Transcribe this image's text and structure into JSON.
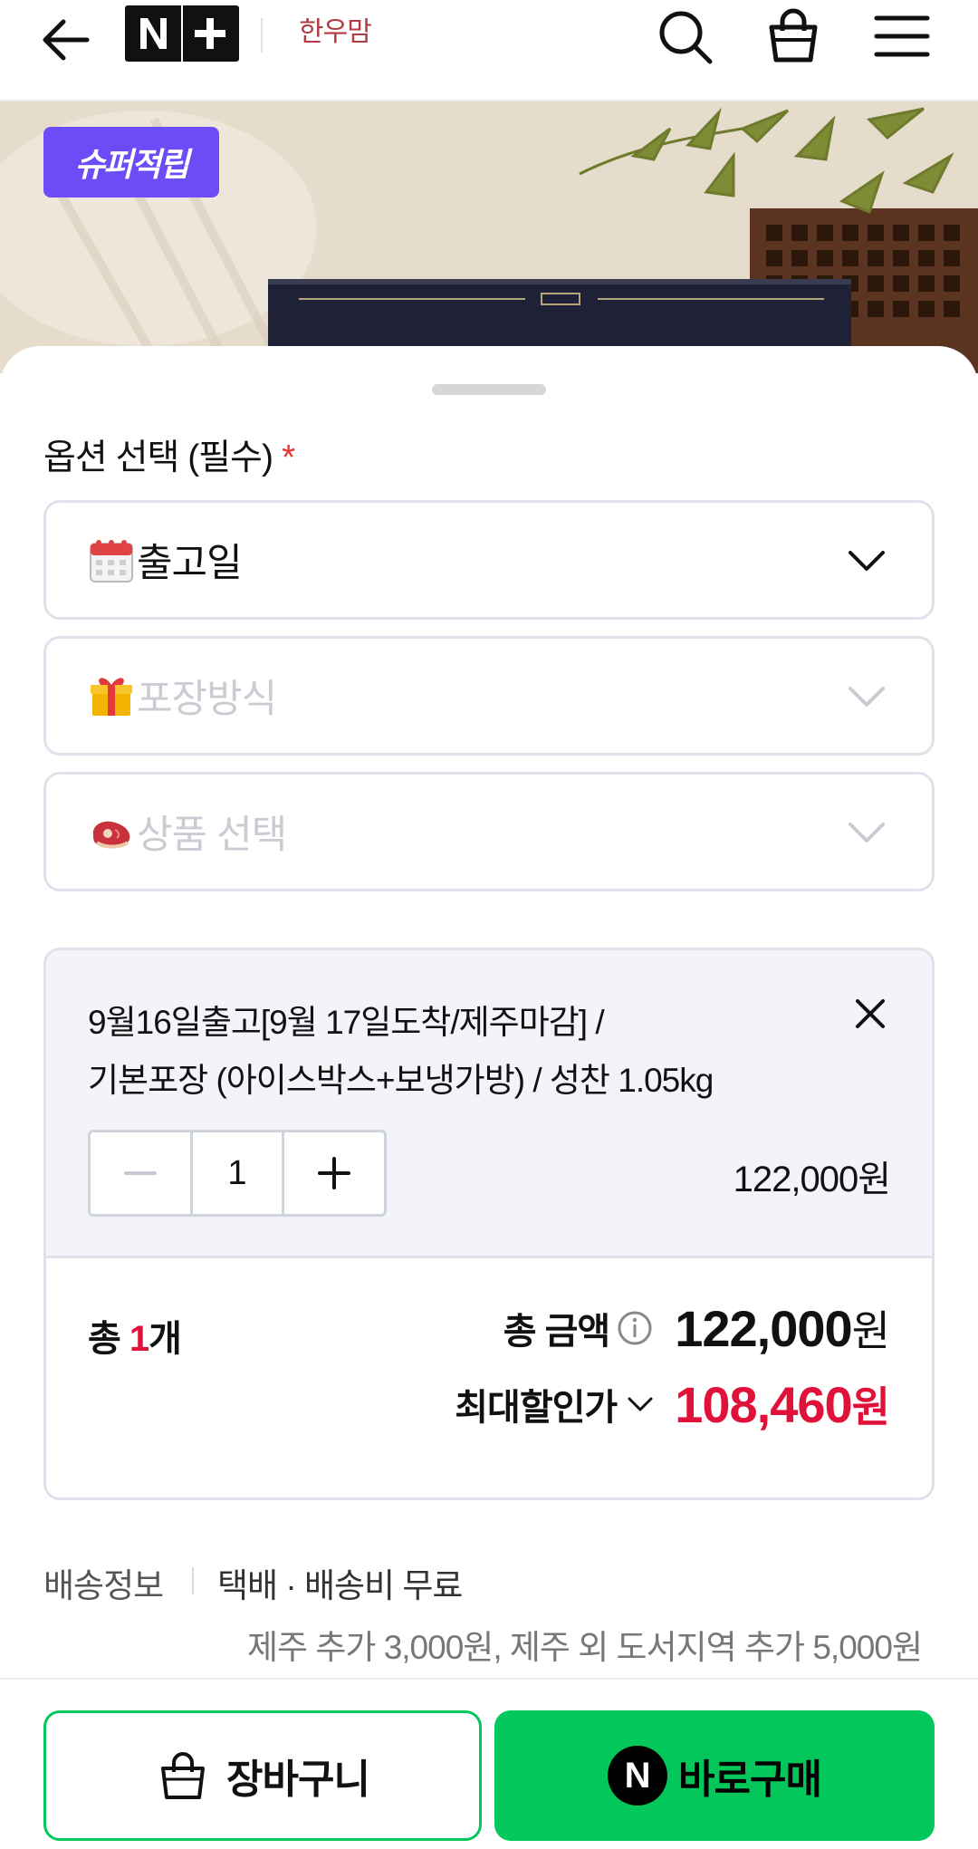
{
  "header": {
    "logo_text": "N+",
    "brand_text": "한우맘",
    "icons": [
      "back-arrow-icon",
      "search-icon",
      "shopping-bag-icon",
      "menu-icon"
    ]
  },
  "hero": {
    "badge": "슈퍼적립",
    "accent": "#6c4cf6"
  },
  "options": {
    "title": "옵션 선택 (필수)",
    "required_mark": "*",
    "selects": [
      {
        "icon": "calendar-icon",
        "label": "출고일",
        "enabled": true
      },
      {
        "icon": "gift-icon",
        "label": "포장방식",
        "enabled": false
      },
      {
        "icon": "meat-icon",
        "label": "상품 선택",
        "enabled": false
      }
    ]
  },
  "selection": {
    "item_line1": "9월16일출고[9월 17일도착/제주마감] /",
    "item_line2": "기본포장 (아이스박스+보냉가방) / 성찬 1.05kg",
    "quantity": "1",
    "item_price": "122,000원",
    "total_count_prefix": "총 ",
    "total_count_number": "1",
    "total_count_suffix": "개",
    "total_label": "총 금액",
    "total_amount": "122,000",
    "currency": "원",
    "discount_label": "최대할인가",
    "discount_amount": "108,460"
  },
  "shipping": {
    "label": "배송정보",
    "value": "택배 · 배송비 무료",
    "extra": "제주 추가 3,000원, 제주 외 도서지역 추가 5,000원"
  },
  "bottom": {
    "cart_label": "장바구니",
    "buy_label": "바로구매",
    "buy_logo": "N",
    "brand_green": "#03c75a",
    "price_red": "#e0123a"
  }
}
